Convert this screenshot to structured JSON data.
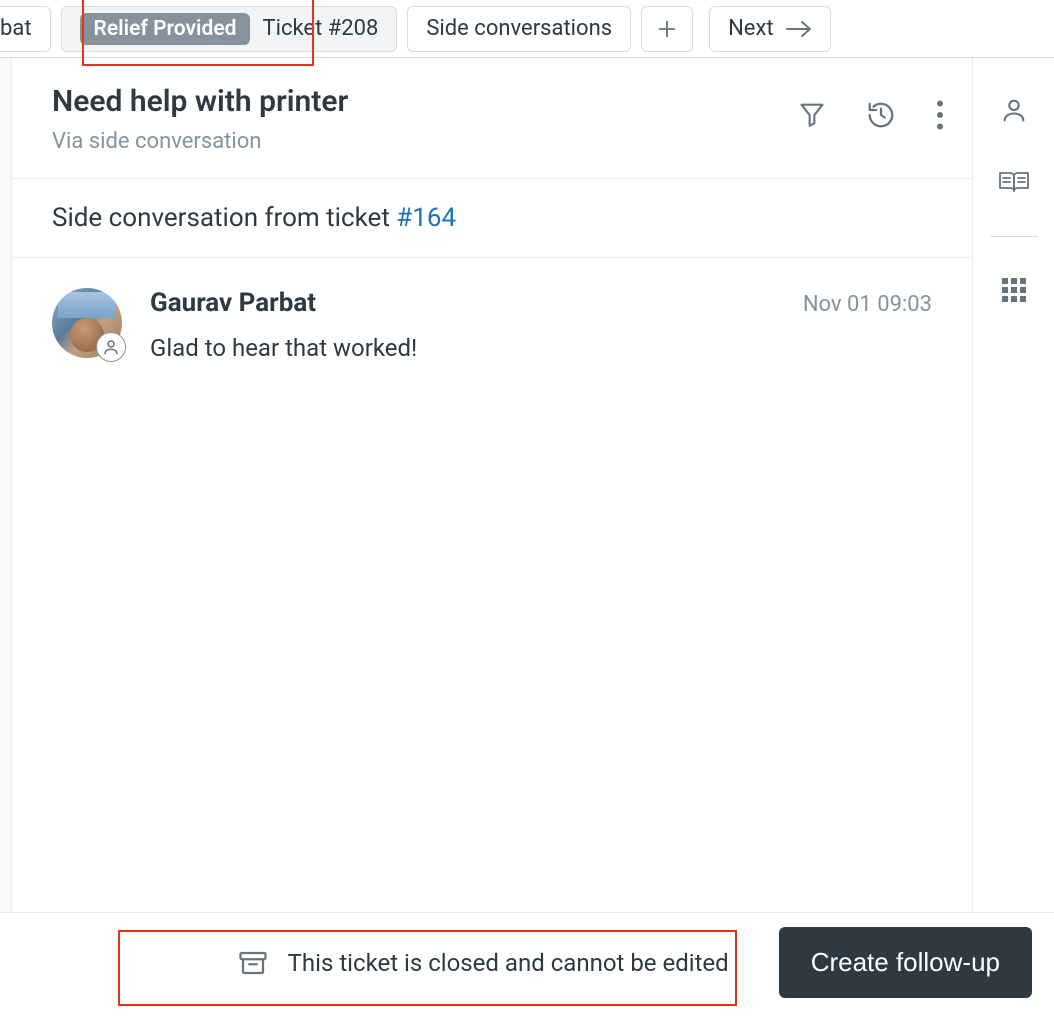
{
  "tabs": {
    "partial_left_label": "bat",
    "active": {
      "status_label": "Relief Provided",
      "ticket_label": "Ticket #208"
    },
    "side_conversations_label": "Side conversations",
    "next_label": "Next"
  },
  "ticket": {
    "title": "Need help with printer",
    "subtitle": "Via side conversation",
    "source_prefix": "Side conversation from ticket ",
    "source_link_label": "#164"
  },
  "message": {
    "author": "Gaurav Parbat",
    "timestamp": "Nov 01 09:03",
    "body": "Glad to hear that worked!"
  },
  "footer": {
    "closed_text": "This ticket is closed and cannot be edited",
    "follow_up_label": "Create follow-up"
  },
  "colors": {
    "link": "#1f73b7",
    "muted": "#87929d",
    "text": "#2f3941",
    "highlight": "#e3331a",
    "button_bg": "#2f3941"
  }
}
